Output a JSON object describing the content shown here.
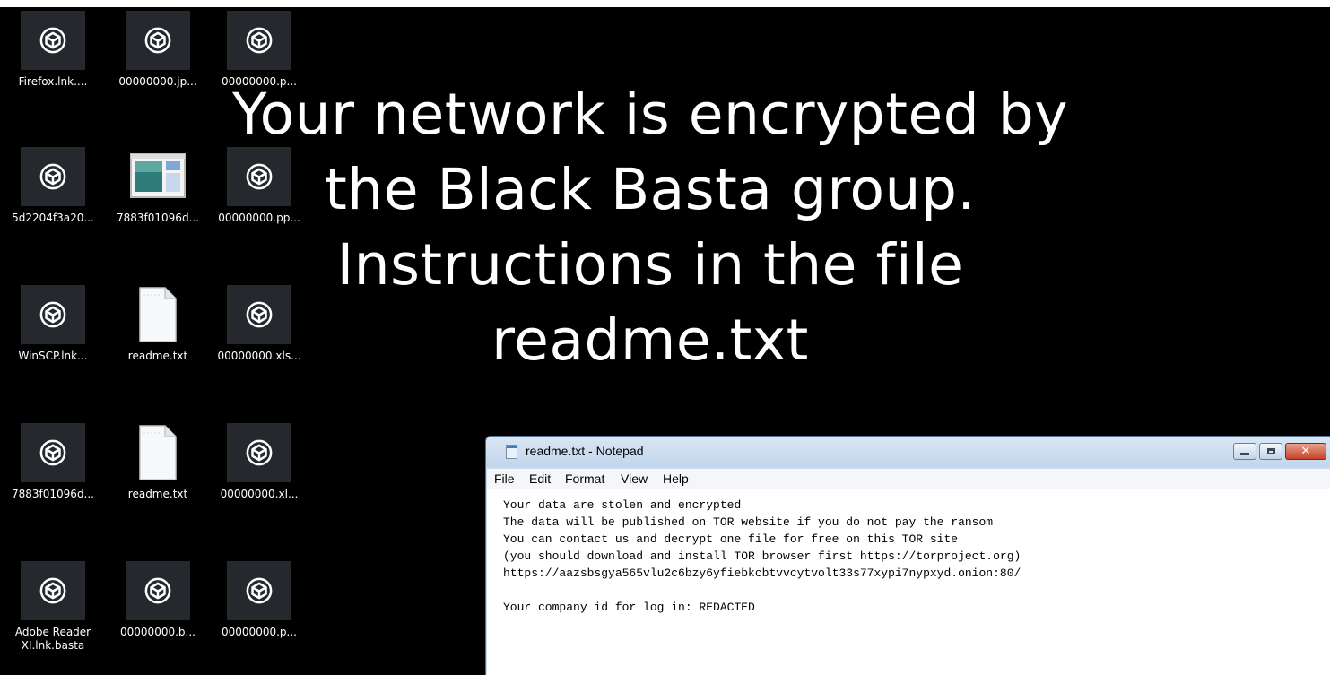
{
  "wallpaper": {
    "lines": [
      "Your network is encrypted by",
      "the Black Basta group.",
      "Instructions in the file",
      "readme.txt"
    ]
  },
  "desktop": {
    "icons": [
      {
        "label": "Firefox.lnk....",
        "icon": "cube-icon"
      },
      {
        "label": "00000000.jp...",
        "icon": "cube-icon"
      },
      {
        "label": "00000000.p...",
        "icon": "cube-icon"
      },
      {
        "label": "5d2204f3a20...",
        "icon": "cube-icon"
      },
      {
        "label": "7883f01096d...",
        "icon": "image-file-icon"
      },
      {
        "label": "00000000.pp...",
        "icon": "cube-icon"
      },
      {
        "label": "WinSCP.lnk...",
        "icon": "cube-icon"
      },
      {
        "label": "readme.txt",
        "icon": "text-file-icon"
      },
      {
        "label": "00000000.xls...",
        "icon": "cube-icon"
      },
      {
        "label": "7883f01096d...",
        "icon": "cube-icon"
      },
      {
        "label": "readme.txt",
        "icon": "text-file-icon"
      },
      {
        "label": "00000000.xl...",
        "icon": "cube-icon"
      },
      {
        "label": "Adobe Reader XI.lnk.basta",
        "icon": "cube-icon"
      },
      {
        "label": "00000000.b...",
        "icon": "cube-icon"
      },
      {
        "label": "00000000.p...",
        "icon": "cube-icon"
      }
    ]
  },
  "notepad": {
    "title": "readme.txt - Notepad",
    "menu": [
      "File",
      "Edit",
      "Format",
      "View",
      "Help"
    ],
    "close_glyph": "✕",
    "lines": [
      "Your data are stolen and encrypted",
      "The data will be published on TOR website if you do not pay the ransom",
      "You can contact us and decrypt one file for free on this TOR site",
      "(you should download and install TOR browser first https://torproject.org)",
      "https://aazsbsgya565vlu2c6bzy6yfiebkcbtvvcytvolt33s77xypi7nypxyd.onion:80/",
      "",
      "Your company id for log in: REDACTED"
    ]
  }
}
